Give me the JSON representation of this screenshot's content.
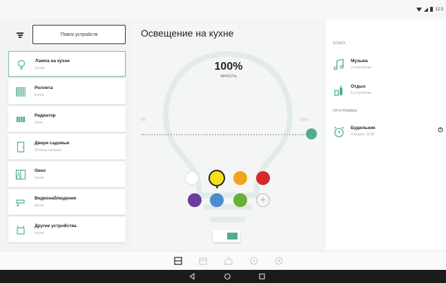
{
  "status_bar": {
    "time": "12:3"
  },
  "left_panel": {
    "search_button": "Поиск устройств",
    "devices": [
      {
        "name": "Лампа на кухне",
        "room": "Кухня",
        "icon": "bulb-icon",
        "active": true
      },
      {
        "name": "Роллета",
        "room": "Кухня",
        "icon": "roller-blind-icon",
        "active": false
      },
      {
        "name": "Радиатор",
        "room": "Зала",
        "icon": "radiator-icon",
        "active": false
      },
      {
        "name": "Двери садовые",
        "room": "Отсеод гостиная",
        "icon": "door-icon",
        "active": false
      },
      {
        "name": "Окно",
        "room": "Кухня",
        "icon": "window-icon",
        "active": false
      },
      {
        "name": "Видеонаблюдение",
        "room": "Кухня",
        "icon": "camera-icon",
        "active": false
      },
      {
        "name": "Другие устройства",
        "room": "Кухня",
        "icon": "other-devices-icon",
        "active": false
      }
    ]
  },
  "center": {
    "title": "Освещение на кухне",
    "brightness_value": "100%",
    "brightness_label": "ЯРКОСТЬ",
    "slider_min_label": "0%",
    "slider_max_label": "100%",
    "slider_level": 1.0,
    "colors": [
      {
        "name": "white",
        "hex": "#ffffff"
      },
      {
        "name": "yellow",
        "hex": "#f7e018",
        "selected": true
      },
      {
        "name": "orange",
        "hex": "#f3a21c"
      },
      {
        "name": "red",
        "hex": "#d42a2a"
      },
      {
        "name": "purple",
        "hex": "#6b3d9a"
      },
      {
        "name": "blue",
        "hex": "#4b8bd0"
      },
      {
        "name": "green",
        "hex": "#6aae3a"
      }
    ],
    "add_color_symbol": "+",
    "toggle_on": true
  },
  "right_panel": {
    "scenes_label": "SCENY",
    "scenes": [
      {
        "name": "Музыка",
        "sub": "3 устройства",
        "icon": "music-icon"
      },
      {
        "name": "Отдых",
        "sub": "4 устройства",
        "icon": "relax-icon"
      }
    ],
    "programs_label": "ПРОГРАММЫ",
    "programs": [
      {
        "name": "Будильник",
        "sub": "Сегодня, 16:00",
        "icon": "alarm-clock-icon"
      }
    ]
  },
  "accent_color": "#4fae8f",
  "tab_bar": {
    "tabs": [
      "devices-tab",
      "rooms-tab",
      "home-tab",
      "scenes-tab",
      "settings-tab"
    ]
  },
  "nav_bar": {
    "buttons": [
      "back-icon",
      "home-icon",
      "recents-icon"
    ]
  }
}
